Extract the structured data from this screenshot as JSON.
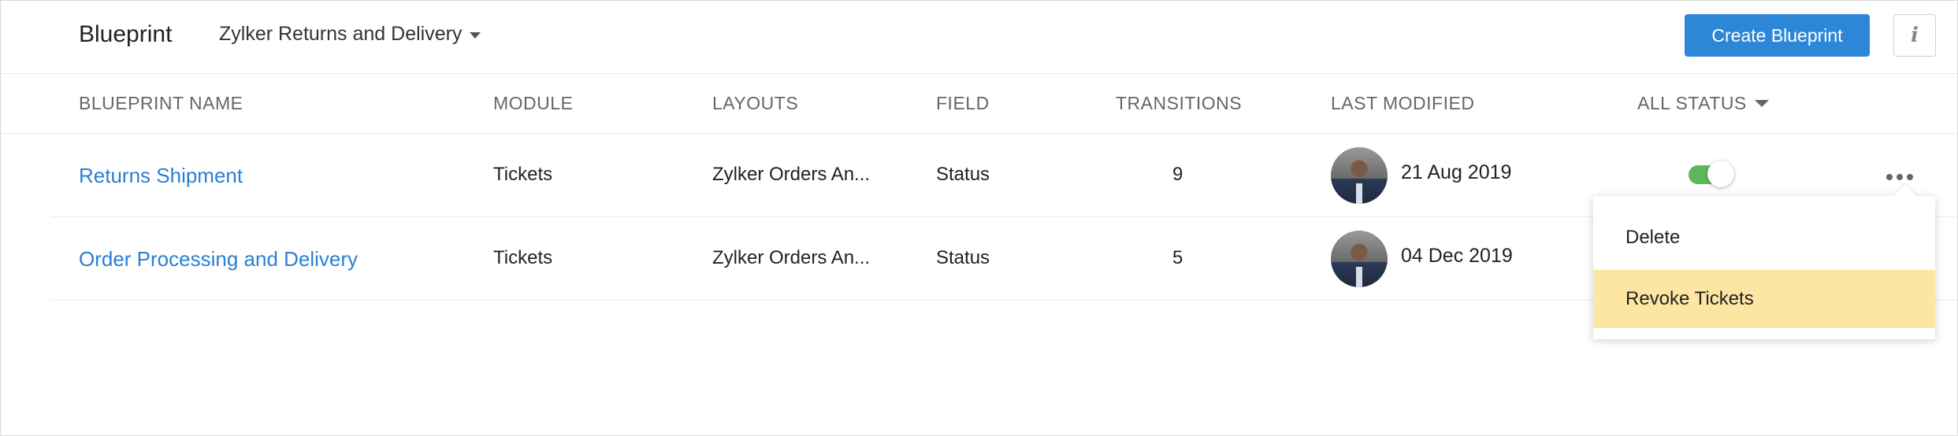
{
  "header": {
    "title": "Blueprint",
    "department": "Zylker Returns and Delivery",
    "create_label": "Create Blueprint",
    "info_label": "i"
  },
  "table": {
    "columns": {
      "name": "BLUEPRINT NAME",
      "module": "MODULE",
      "layouts": "LAYOUTS",
      "field": "FIELD",
      "transitions": "TRANSITIONS",
      "last_modified": "LAST MODIFIED",
      "status": "ALL STATUS"
    },
    "rows": [
      {
        "name": "Returns Shipment",
        "module": "Tickets",
        "layout": "Zylker Orders An...",
        "field": "Status",
        "transitions": "9",
        "modified": "21 Aug 2019",
        "active": true
      },
      {
        "name": "Order Processing and Delivery",
        "module": "Tickets",
        "layout": "Zylker Orders An...",
        "field": "Status",
        "transitions": "5",
        "modified": "04 Dec 2019",
        "active": true
      }
    ]
  },
  "menu": {
    "items": [
      "Delete",
      "Revoke Tickets"
    ],
    "highlighted": "Revoke Tickets"
  },
  "colors": {
    "accent": "#2d87d8",
    "link": "#2a7fd4",
    "toggle_on": "#5cb85c",
    "menu_highlight": "#fde6a3"
  },
  "icons": {
    "info": "info-icon",
    "more": "more-options-icon",
    "dropdown": "chevron-down-icon"
  }
}
